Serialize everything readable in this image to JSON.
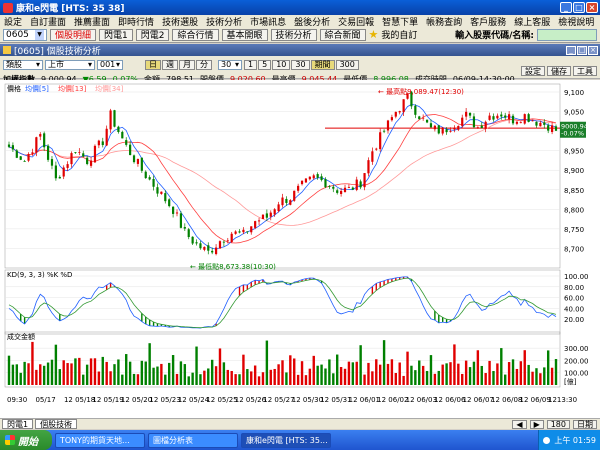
{
  "window": {
    "title": "康和e閃電 [HTS: 35 38]"
  },
  "menu": [
    "設定",
    "自訂畫面",
    "推薦畫面",
    "即時行情",
    "技術選股",
    "技術分析",
    "市場訊息",
    "盤後分析",
    "交易回報",
    "智慧下單",
    "帳務查詢",
    "客戶服務",
    "線上客服",
    "檢視說明"
  ],
  "toolbar": {
    "stock_code": "0605",
    "buttons": [
      "個股明細",
      "閃電1",
      "閃電2",
      "綜合行情",
      "基本開眼",
      "技術分析",
      "綜合新聞"
    ],
    "favorites": "我的自訂",
    "stock_input_label": "輸入股票代碼/名稱:"
  },
  "panel": {
    "title": "[0605] 個股技術分析"
  },
  "controls": {
    "category": "類股",
    "market": "上市",
    "code": "001",
    "periods": [
      "日",
      "週",
      "月",
      "分"
    ],
    "minutes": "30",
    "intervals": [
      "1",
      "5",
      "10",
      "30",
      "期間",
      "300"
    ],
    "right_buttons": [
      "設定",
      "儲存",
      "工具"
    ]
  },
  "info": {
    "name": "加權指數",
    "price": "9,000.94",
    "change": "▼6.59",
    "pct": "0.07%",
    "amount_label": "金額",
    "amount": "798.51",
    "high_label": "最高",
    "open_label": "開盤價",
    "open": "9,020.60",
    "high_label2": "最高價",
    "high": "9,045.44",
    "low_label": "最低價",
    "low": "8,996.08",
    "time_label": "成交時間",
    "time": "06/09-14:30:00"
  },
  "legend": {
    "price": "價格",
    "ma5": "均價[5]",
    "ma13": "均價[13]",
    "ma34": "均價[34]",
    "kd": "KD(9, 3, 3)",
    "k": "%K",
    "d": "%D",
    "volume": "成交金額",
    "high_label": "最高點9,089.47(12:30)",
    "low_label": "最低點8,673.38(10:30)",
    "price_tag": "9000.94",
    "pct_tag": "-0.07%",
    "vol_unit": "[億]"
  },
  "chart_data": {
    "type": "candlestick",
    "price_axis": {
      "min": 8650,
      "max": 9100,
      "ticks": [
        9100,
        9050,
        9000,
        8950,
        8900,
        8850,
        8800,
        8750,
        8700
      ]
    },
    "kd_axis": {
      "ticks": [
        100,
        80,
        60,
        40,
        20
      ]
    },
    "vol_axis": {
      "ticks": [
        300,
        200,
        100
      ]
    },
    "dates": [
      "09:30",
      "05/17",
      "12 05/18",
      "12 05/19",
      "12 05/20",
      "12 05/23",
      "12 05/24",
      "12 05/25",
      "12 05/26",
      "12 05/27",
      "12 05/30",
      "12 05/31",
      "12 06/01",
      "12 06/02",
      "12 06/03",
      "12 06/06",
      "12 06/07",
      "12 06/08",
      "12 06/09",
      "1213:30"
    ],
    "last_price": 9000.94,
    "ref_price": 9007.53,
    "highest": 9089.47,
    "lowest": 8673.38,
    "anchors": [
      [
        0,
        8960
      ],
      [
        4,
        8925
      ],
      [
        8,
        8990
      ],
      [
        12,
        8875
      ],
      [
        17,
        8955
      ],
      [
        20,
        8925
      ],
      [
        24,
        8975
      ],
      [
        26,
        9040
      ],
      [
        30,
        8960
      ],
      [
        34,
        8900
      ],
      [
        38,
        8850
      ],
      [
        42,
        8800
      ],
      [
        45,
        8740
      ],
      [
        48,
        8710
      ],
      [
        51,
        8690
      ],
      [
        54,
        8720
      ],
      [
        57,
        8740
      ],
      [
        60,
        8735
      ],
      [
        63,
        8770
      ],
      [
        66,
        8780
      ],
      [
        69,
        8820
      ],
      [
        72,
        8830
      ],
      [
        75,
        8860
      ],
      [
        78,
        8880
      ],
      [
        81,
        8870
      ],
      [
        84,
        8850
      ],
      [
        87,
        8850
      ],
      [
        90,
        8870
      ],
      [
        93,
        8950
      ],
      [
        96,
        9000
      ],
      [
        99,
        9050
      ],
      [
        102,
        9085
      ],
      [
        105,
        9040
      ],
      [
        108,
        9005
      ],
      [
        111,
        9000
      ],
      [
        114,
        9020
      ],
      [
        117,
        9040
      ],
      [
        120,
        9010
      ],
      [
        123,
        9040
      ],
      [
        126,
        9045
      ],
      [
        129,
        9030
      ],
      [
        132,
        9040
      ],
      [
        135,
        9025
      ],
      [
        138,
        9015
      ],
      [
        140,
        9000
      ]
    ]
  },
  "tabs": [
    "閃電1",
    "個股技術"
  ],
  "bottom_controls": [
    "180",
    "日期"
  ],
  "taskbar": {
    "start": "開始",
    "tasks": [
      "TONY的期貨天地...",
      "圖檔分析表",
      "康和e閃電 [HTS: 35..."
    ],
    "clock": "上午 01:59"
  },
  "colors": {
    "up": "#e00000",
    "down": "#008000",
    "ma5": "#1f5fff",
    "ma13": "#ff4040",
    "ma34": "#ff9999",
    "ref_line": "#e00000"
  }
}
